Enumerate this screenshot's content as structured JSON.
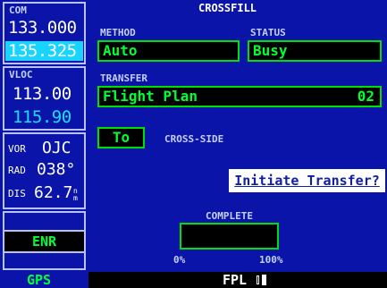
{
  "radios": {
    "com": {
      "label": "COM",
      "active": "133.000",
      "standby": "135.325"
    },
    "vloc": {
      "label": "VLOC",
      "active": "113.00",
      "standby": "115.90"
    },
    "vor": {
      "label": "VOR",
      "ident": "OJC"
    },
    "rad": {
      "label": "RAD",
      "value": "038°"
    },
    "dis": {
      "label": "DIS",
      "value": "62.7",
      "unit": "nm"
    },
    "mode": "ENR"
  },
  "page": {
    "title": "CROSSFILL",
    "method_label": "METHOD",
    "method_value": "Auto",
    "status_label": "STATUS",
    "status_value": "Busy",
    "transfer_label": "TRANSFER",
    "transfer_value": "Flight Plan",
    "transfer_number": "02",
    "direction_value": "To",
    "cross_side_label": "CROSS-SIDE",
    "initiate_label": "Initiate Transfer?",
    "complete_label": "COMPLETE",
    "progress_min": "0%",
    "progress_max": "100%",
    "progress_fraction": 0
  },
  "bottom": {
    "left": "GPS",
    "page": "FPL"
  },
  "colors": {
    "bg": "#0a14a8",
    "field_border": "#00e000",
    "field_text": "#00ff33",
    "standby": "#19d4ff"
  }
}
